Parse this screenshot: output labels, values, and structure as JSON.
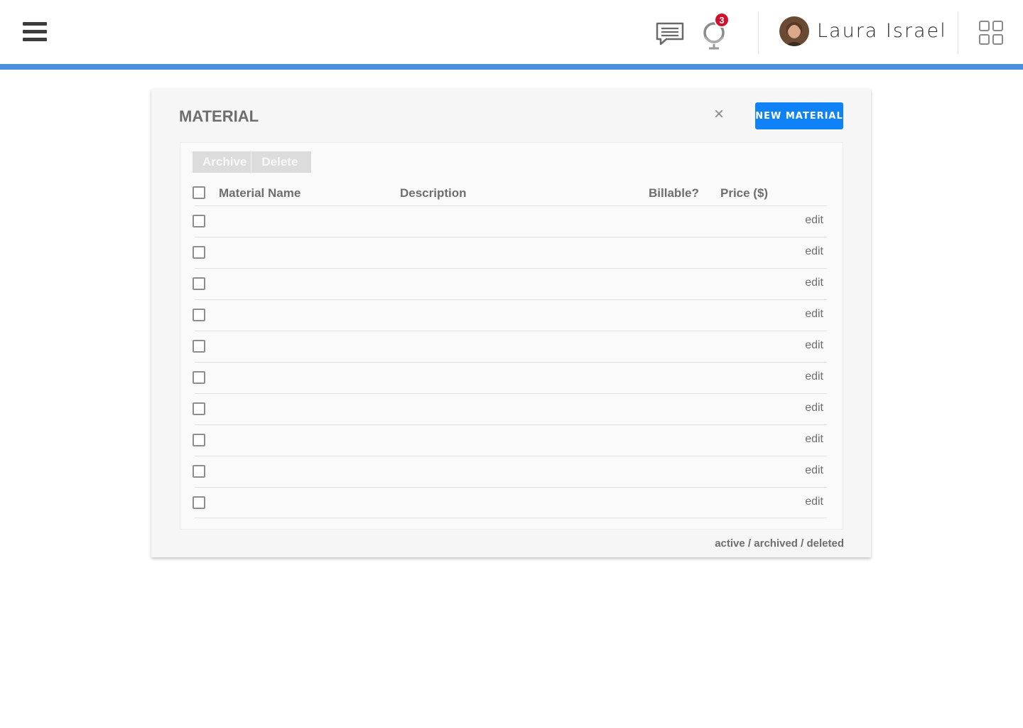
{
  "colors": {
    "accent_bar": "#4a8fde",
    "primary_button": "#0f82f7",
    "badge": "#d0112b"
  },
  "header": {
    "user_name": "Laura Israel",
    "notification_count": "3",
    "icons": [
      "hamburger-menu-icon",
      "chat-icon",
      "globe-icon",
      "apps-grid-icon"
    ]
  },
  "panel": {
    "title": "MATERIAL",
    "close_label": "×",
    "new_button_label": "NEW MATERIAL",
    "bulk_actions": {
      "archive": "Archive",
      "delete": "Delete"
    },
    "columns": {
      "name": "Material Name",
      "description": "Description",
      "billable": "Billable?",
      "price": "Price ($)"
    },
    "rows": [
      {
        "edit": "edit"
      },
      {
        "edit": "edit"
      },
      {
        "edit": "edit"
      },
      {
        "edit": "edit"
      },
      {
        "edit": "edit"
      },
      {
        "edit": "edit"
      },
      {
        "edit": "edit"
      },
      {
        "edit": "edit"
      },
      {
        "edit": "edit"
      },
      {
        "edit": "edit"
      }
    ],
    "status_filter": {
      "active": "active",
      "archived": "archived",
      "deleted": "deleted",
      "separator": " / "
    }
  }
}
